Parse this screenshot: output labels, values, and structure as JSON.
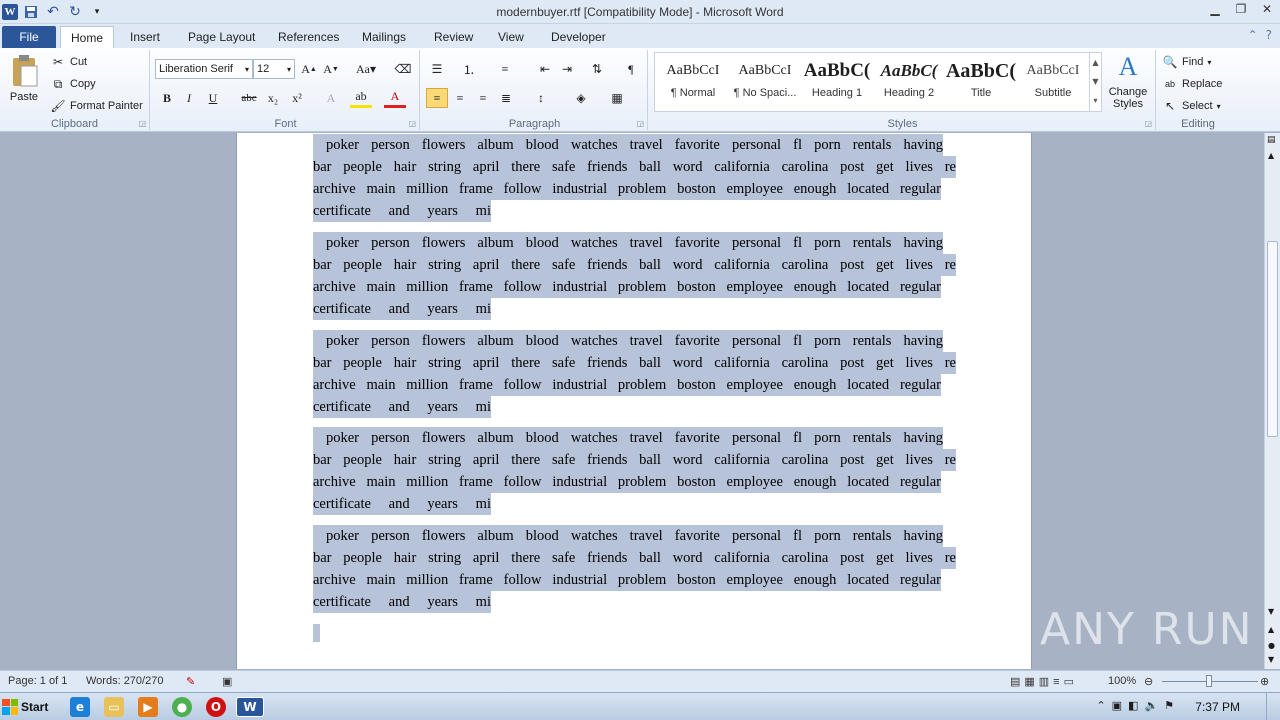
{
  "window": {
    "title": "modernbuyer.rtf [Compatibility Mode] - Microsoft Word",
    "logo": "W"
  },
  "tabs": [
    "File",
    "Home",
    "Insert",
    "Page Layout",
    "References",
    "Mailings",
    "Review",
    "View",
    "Developer"
  ],
  "ribbon": {
    "clipboard": {
      "label": "Clipboard",
      "paste": "Paste",
      "cut": "Cut",
      "copy": "Copy",
      "format_painter": "Format Painter"
    },
    "font": {
      "label": "Font",
      "font_name": "Liberation Serif",
      "font_size": "12"
    },
    "paragraph": {
      "label": "Paragraph"
    },
    "styles": {
      "label": "Styles",
      "items": [
        {
          "sample": "AaBbCcI",
          "name": "¶ Normal"
        },
        {
          "sample": "AaBbCcI",
          "name": "¶ No Spaci..."
        },
        {
          "sample": "AaBbC(",
          "name": "Heading 1"
        },
        {
          "sample": "AaBbC(",
          "name": "Heading 2"
        },
        {
          "sample": "AaBbC(",
          "name": "Title"
        },
        {
          "sample": "AaBbCcI",
          "name": "Subtitle"
        }
      ],
      "change_styles": "Change Styles"
    },
    "editing": {
      "label": "Editing",
      "find": "Find",
      "replace": "Replace",
      "select": "Select"
    }
  },
  "document": {
    "lines": [
      "poker person flowers album blood watches travel favorite personal fl porn rentals having",
      "bar people hair string april there safe friends ball word california carolina post get lives re",
      "archive main million frame follow industrial problem boston employee enough located regular",
      "certificate and years mi"
    ]
  },
  "status": {
    "page": "Page: 1 of 1",
    "words": "Words: 270/270",
    "zoom": "100%"
  },
  "taskbar": {
    "start": "Start",
    "clock": "7:37 PM"
  },
  "watermark": "ANY RUN"
}
